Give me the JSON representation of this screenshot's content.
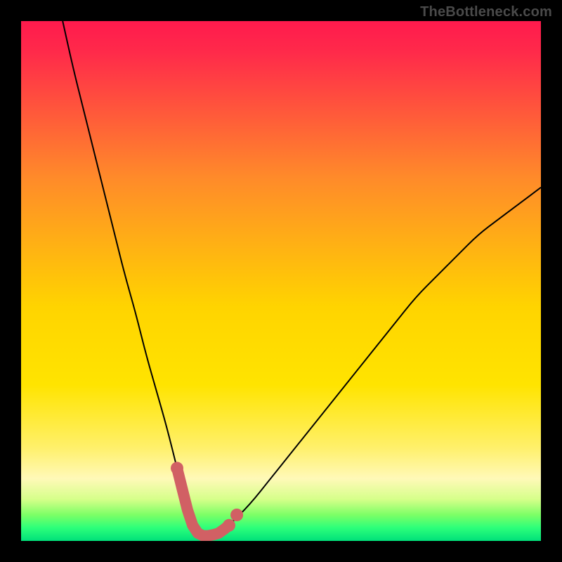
{
  "watermark": "TheBottleneck.com",
  "colors": {
    "frame": "#000000",
    "curve": "#000000",
    "marker": "#d16064",
    "gradient_stops": [
      {
        "offset": 0,
        "color": "#ff1a4d"
      },
      {
        "offset": 0.06,
        "color": "#ff2a4a"
      },
      {
        "offset": 0.3,
        "color": "#ff8a2a"
      },
      {
        "offset": 0.55,
        "color": "#ffd400"
      },
      {
        "offset": 0.7,
        "color": "#ffe400"
      },
      {
        "offset": 0.82,
        "color": "#fff06a"
      },
      {
        "offset": 0.88,
        "color": "#fff9b8"
      },
      {
        "offset": 0.92,
        "color": "#d6ff8a"
      },
      {
        "offset": 0.95,
        "color": "#7cff66"
      },
      {
        "offset": 0.975,
        "color": "#2cff7a"
      },
      {
        "offset": 1.0,
        "color": "#00e07a"
      }
    ]
  },
  "chart_data": {
    "type": "line",
    "title": "",
    "xlabel": "",
    "ylabel": "",
    "xlim": [
      0,
      100
    ],
    "ylim": [
      0,
      100
    ],
    "series": [
      {
        "name": "bottleneck-curve",
        "x": [
          8,
          10,
          12,
          14,
          16,
          18,
          20,
          22,
          24,
          26,
          28,
          30,
          31,
          32,
          33,
          34,
          35,
          36,
          38,
          40,
          44,
          48,
          52,
          56,
          60,
          64,
          68,
          72,
          76,
          80,
          84,
          88,
          92,
          96,
          100
        ],
        "y": [
          100,
          91,
          83,
          75,
          67,
          59,
          51,
          44,
          36,
          29,
          22,
          14,
          10,
          6,
          3,
          1.5,
          1,
          1,
          1.5,
          3,
          7,
          12,
          17,
          22,
          27,
          32,
          37,
          42,
          47,
          51,
          55,
          59,
          62,
          65,
          68
        ]
      }
    ],
    "highlight": {
      "name": "optimal-range",
      "x": [
        30,
        31,
        32,
        33,
        34,
        35,
        36,
        37,
        38,
        39,
        40
      ],
      "y": [
        14,
        10,
        6,
        3,
        1.5,
        1,
        1,
        1.2,
        1.5,
        2.2,
        3
      ]
    },
    "highlight_upper_point": {
      "x": 41.5,
      "y": 5
    }
  }
}
